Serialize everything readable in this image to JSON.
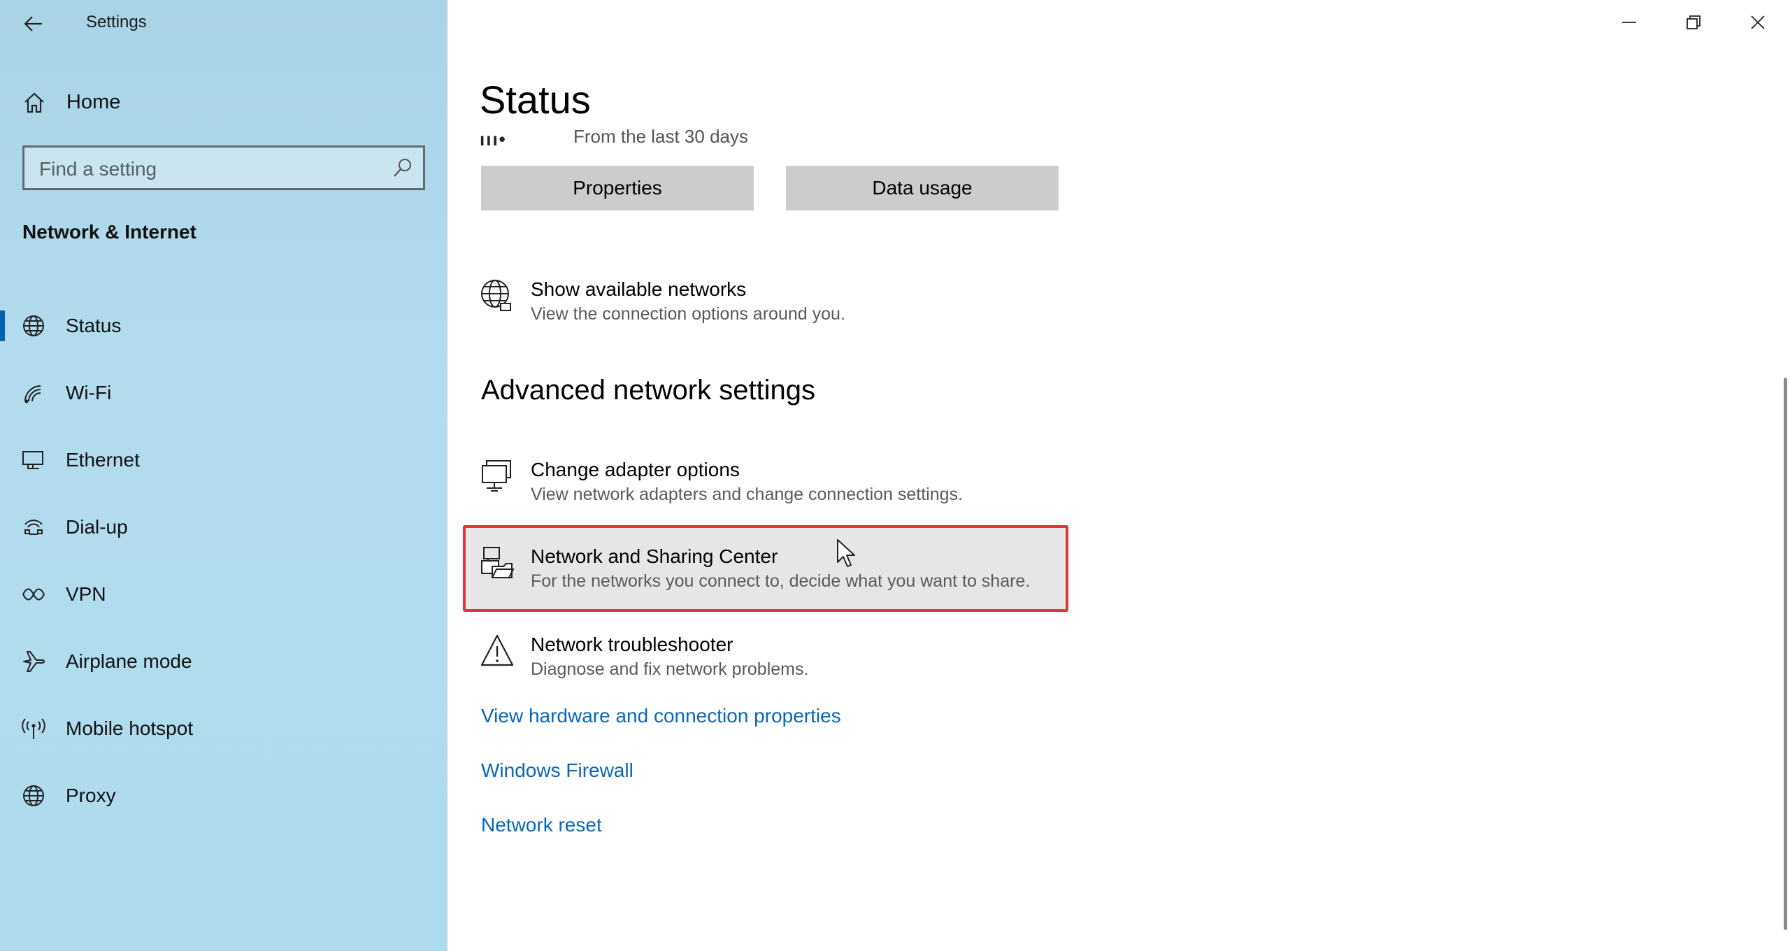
{
  "app": {
    "title": "Settings"
  },
  "sidebar": {
    "home_label": "Home",
    "search_placeholder": "Find a setting",
    "section_title": "Network & Internet",
    "items": [
      {
        "label": "Status",
        "icon": "globe-icon",
        "active": true
      },
      {
        "label": "Wi-Fi",
        "icon": "wifi-icon",
        "active": false
      },
      {
        "label": "Ethernet",
        "icon": "ethernet-icon",
        "active": false
      },
      {
        "label": "Dial-up",
        "icon": "dialup-icon",
        "active": false
      },
      {
        "label": "VPN",
        "icon": "vpn-icon",
        "active": false
      },
      {
        "label": "Airplane mode",
        "icon": "airplane-icon",
        "active": false
      },
      {
        "label": "Mobile hotspot",
        "icon": "hotspot-icon",
        "active": false
      },
      {
        "label": "Proxy",
        "icon": "globe-icon",
        "active": false
      }
    ]
  },
  "main": {
    "title": "Status",
    "usage_text": "From the last 30 days",
    "properties_label": "Properties",
    "data_usage_label": "Data usage",
    "show_networks": {
      "title": "Show available networks",
      "desc": "View the connection options around you."
    },
    "advanced_heading": "Advanced network settings",
    "adapter": {
      "title": "Change adapter options",
      "desc": "View network adapters and change connection settings."
    },
    "sharing_center": {
      "title": "Network and Sharing Center",
      "desc": "For the networks you connect to, decide what you want to share."
    },
    "troubleshooter": {
      "title": "Network troubleshooter",
      "desc": "Diagnose and fix network problems."
    },
    "links": {
      "hardware": "View hardware and connection properties",
      "firewall": "Windows Firewall",
      "reset": "Network reset"
    }
  },
  "colors": {
    "accent": "#0063b1",
    "link": "#0a66b8",
    "highlight_border": "#e0353b"
  }
}
